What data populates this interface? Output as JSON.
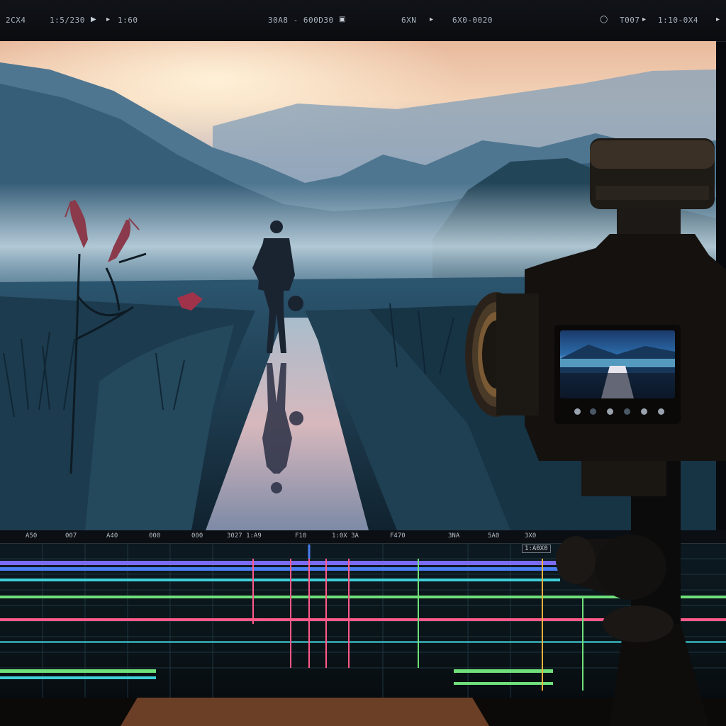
{
  "toolbar": {
    "left": [
      "2CX4",
      "1:5/230",
      "1:60"
    ],
    "center": [
      "30A8 - 600D30",
      "6XN",
      "6X0-0020"
    ],
    "right": [
      "0",
      "T007",
      "1:10-0X4"
    ]
  },
  "timeline": {
    "ruler_labels": [
      "A50",
      "007",
      "A40",
      "000",
      "3027 1:A9",
      "F10",
      "1:0X 3A",
      "F470",
      "3NA",
      "5A0",
      "3X0"
    ],
    "badge": "1:A0X0",
    "colors": {
      "purple": "#7a6cf0",
      "blue": "#4a7ef0",
      "cyan": "#3fd0d8",
      "green": "#6fe07a",
      "pink": "#ff5a8a",
      "orange": "#ffb040"
    }
  },
  "scene": {
    "sky_top": "#f2c4a2",
    "mist": "#a9c4d2",
    "water": "#d8b8b8"
  }
}
